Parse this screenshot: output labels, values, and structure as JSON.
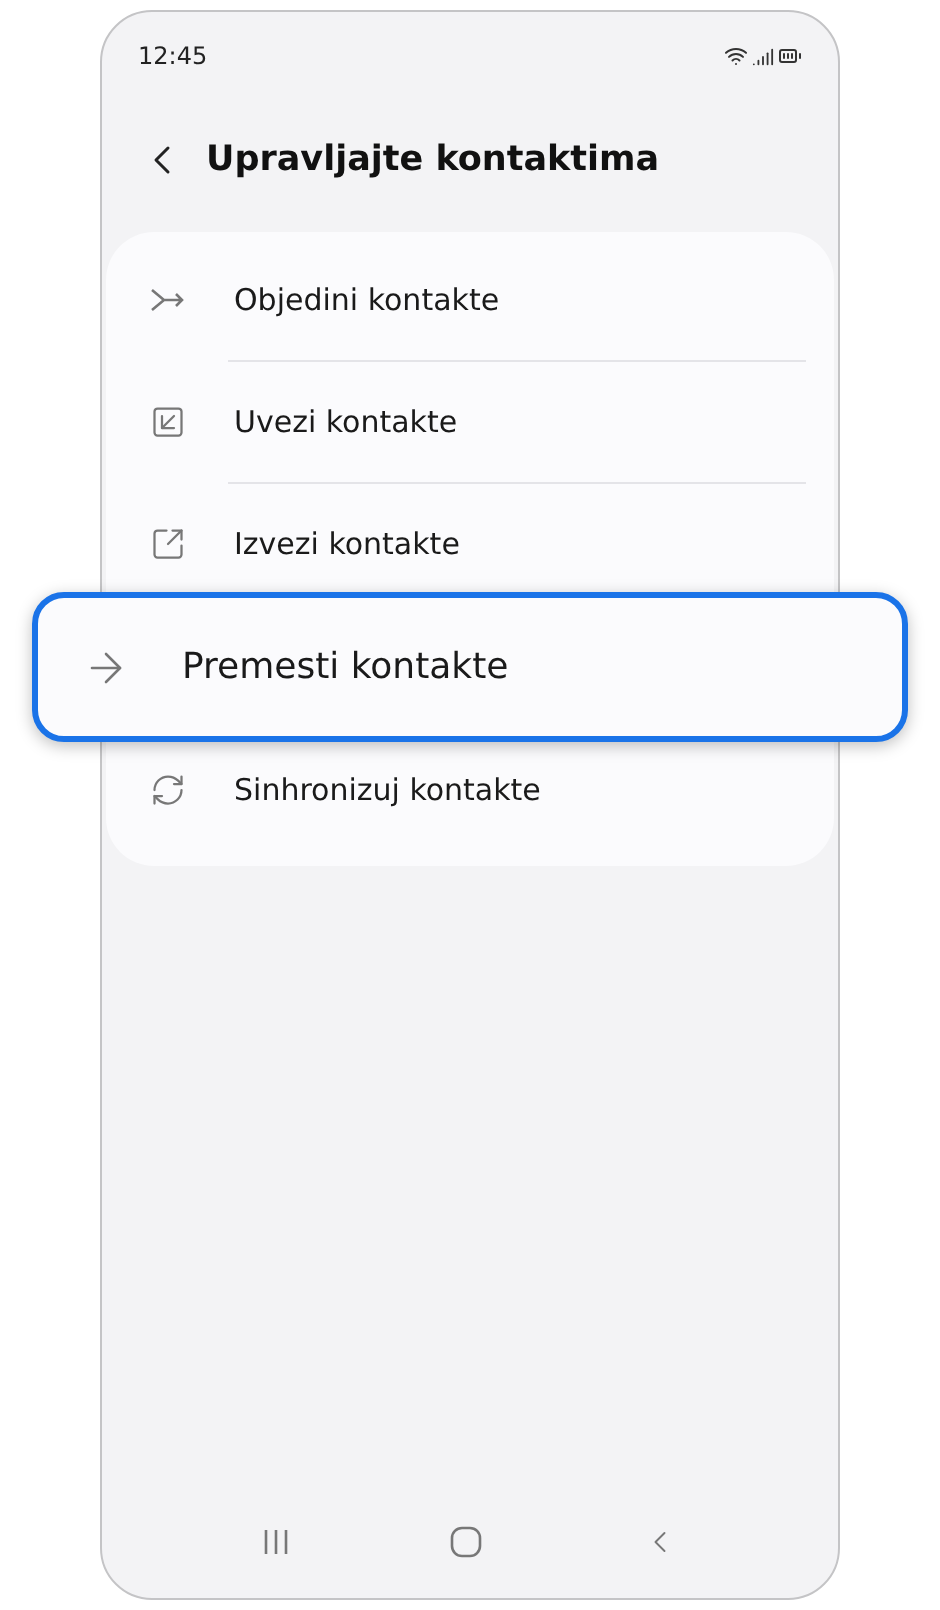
{
  "status_bar": {
    "time": "12:45"
  },
  "header": {
    "title": "Upravljajte kontaktima"
  },
  "items": [
    {
      "label": "Objedini kontakte",
      "highlighted": false
    },
    {
      "label": "Uvezi kontakte",
      "highlighted": false
    },
    {
      "label": "Izvezi kontakte",
      "highlighted": false
    },
    {
      "label": "Premesti kontakte",
      "highlighted": true
    },
    {
      "label": "Sinhronizuj kontakte",
      "highlighted": false
    }
  ]
}
